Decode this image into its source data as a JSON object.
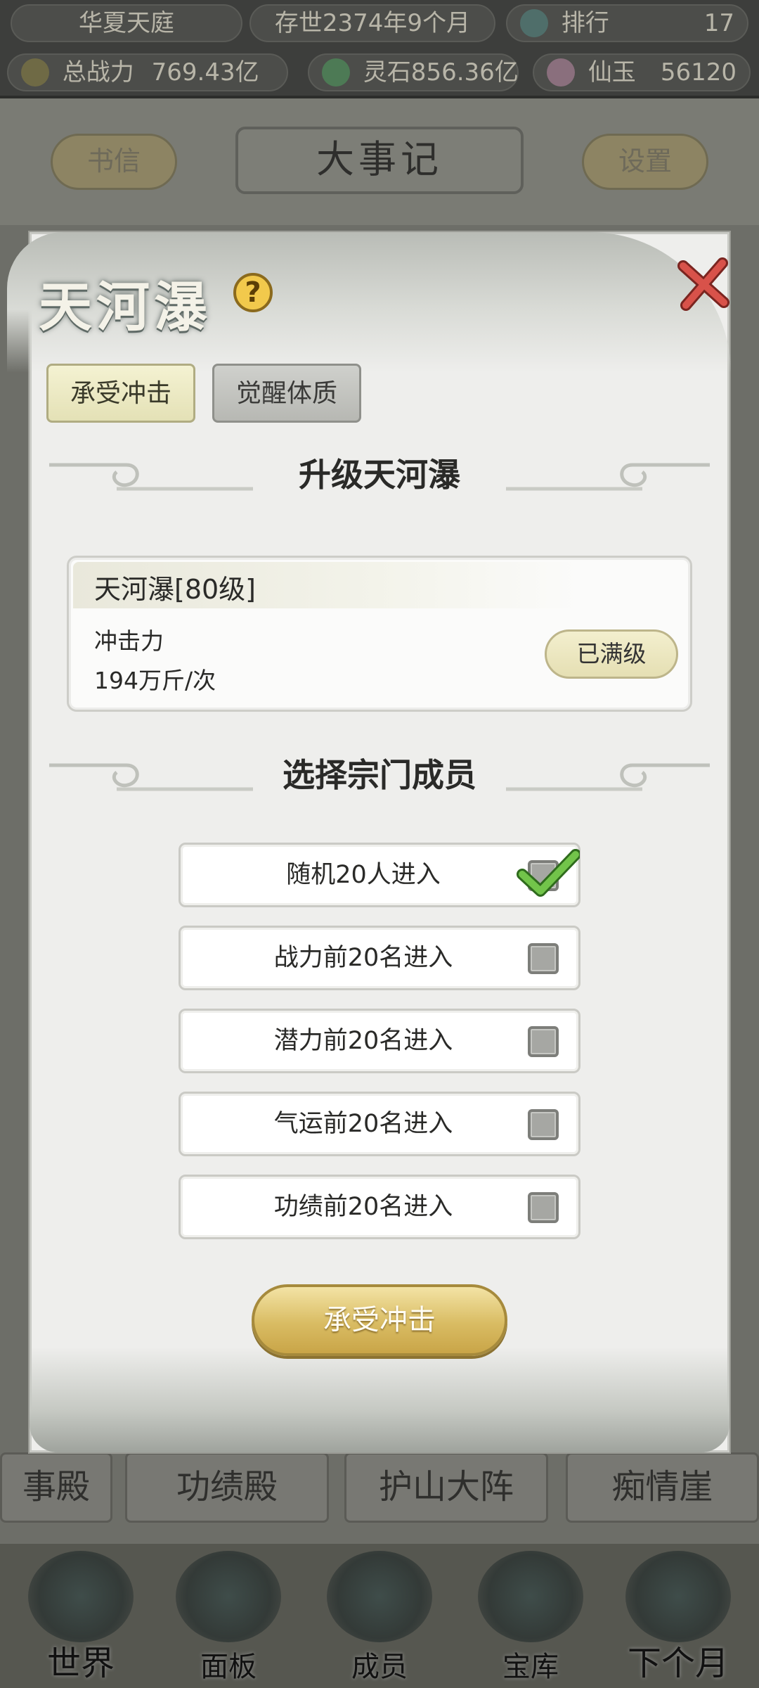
{
  "topbar": {
    "sect_name": "华夏天庭",
    "era": "存世2374年9个月",
    "rank_label": "排行",
    "rank_value": "17",
    "power_label": "总战力",
    "power_value": "769.43亿",
    "spirit_stone": "灵石856.36亿",
    "jade_label": "仙玉",
    "jade_value": "56120"
  },
  "header": {
    "letters": "书信",
    "title": "大事记",
    "settings": "设置"
  },
  "background_buildings": [
    "事殿",
    "功绩殿",
    "护山大阵",
    "痴情崖"
  ],
  "bottom_nav": [
    {
      "label": "世界",
      "icon": "world-icon"
    },
    {
      "label": "面板",
      "icon": "panel-icon"
    },
    {
      "label": "成员",
      "icon": "members-icon"
    },
    {
      "label": "宝库",
      "icon": "treasury-icon"
    },
    {
      "label": "下个月",
      "icon": "next-month-icon"
    }
  ],
  "modal": {
    "title": "天河瀑",
    "help": "?",
    "tabs": [
      {
        "label": "承受冲击",
        "active": true
      },
      {
        "label": "觉醒体质",
        "active": false
      }
    ],
    "upgrade_section": "升级天河瀑",
    "card": {
      "name": "天河瀑[80级]",
      "stat_label": "冲击力",
      "stat_value": "194万斤/次",
      "max_label": "已满级"
    },
    "select_section": "选择宗门成员",
    "options": [
      {
        "label": "随机20人进入",
        "checked": true
      },
      {
        "label": "战力前20名进入",
        "checked": false
      },
      {
        "label": "潜力前20名进入",
        "checked": false
      },
      {
        "label": "气运前20名进入",
        "checked": false
      },
      {
        "label": "功绩前20名进入",
        "checked": false
      }
    ],
    "confirm": "承受冲击"
  },
  "colors": {
    "accent_gold": "#d9bc63",
    "check_green": "#5fb83a",
    "close_red": "#c9413a"
  }
}
